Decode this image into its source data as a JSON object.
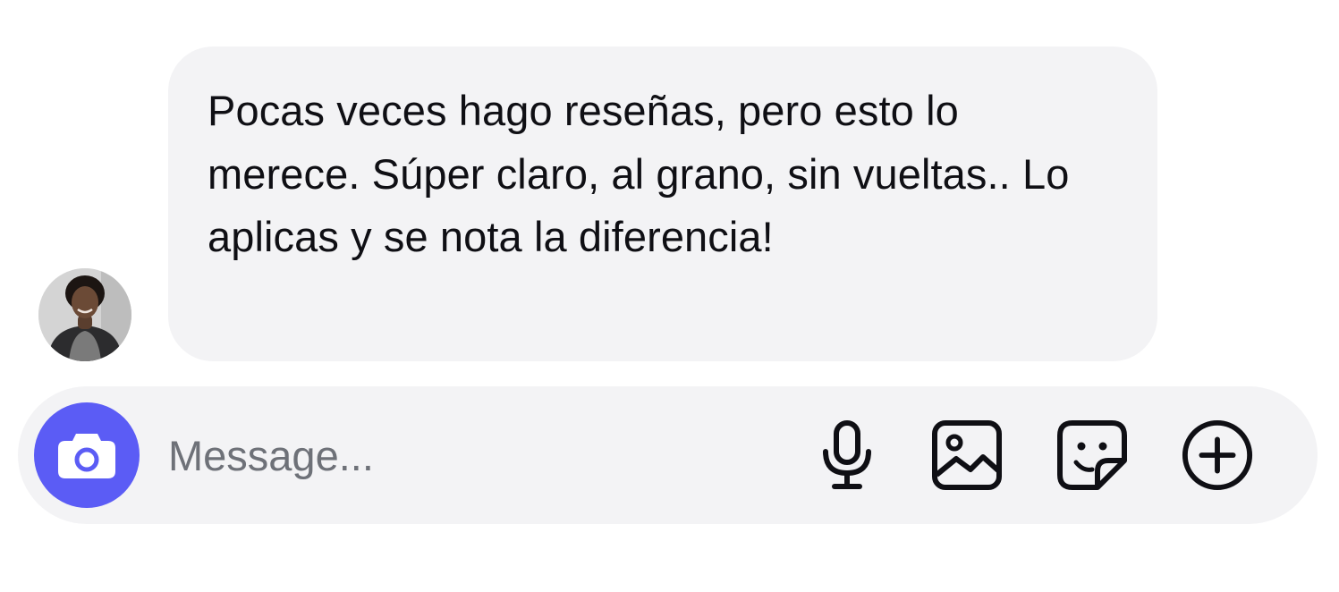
{
  "message": {
    "text": "Pocas veces hago reseñas, pero esto lo merece. Súper claro, al grano, sin vueltas.. Lo aplicas y se nota la diferencia!",
    "sender_avatar": "profile-photo"
  },
  "composer": {
    "placeholder": "Message...",
    "value": "",
    "camera_icon": "camera-icon",
    "actions": [
      {
        "name": "microphone",
        "icon": "microphone-icon"
      },
      {
        "name": "gallery",
        "icon": "image-icon"
      },
      {
        "name": "sticker",
        "icon": "sticker-icon"
      },
      {
        "name": "more",
        "icon": "plus-circle-icon"
      }
    ]
  },
  "colors": {
    "bubble_background": "#f3f3f5",
    "composer_background": "#f3f3f5",
    "camera_button": "#5b5cf5",
    "text": "#0f0f14",
    "placeholder": "#6e7178",
    "icon": "#0f0f14"
  }
}
